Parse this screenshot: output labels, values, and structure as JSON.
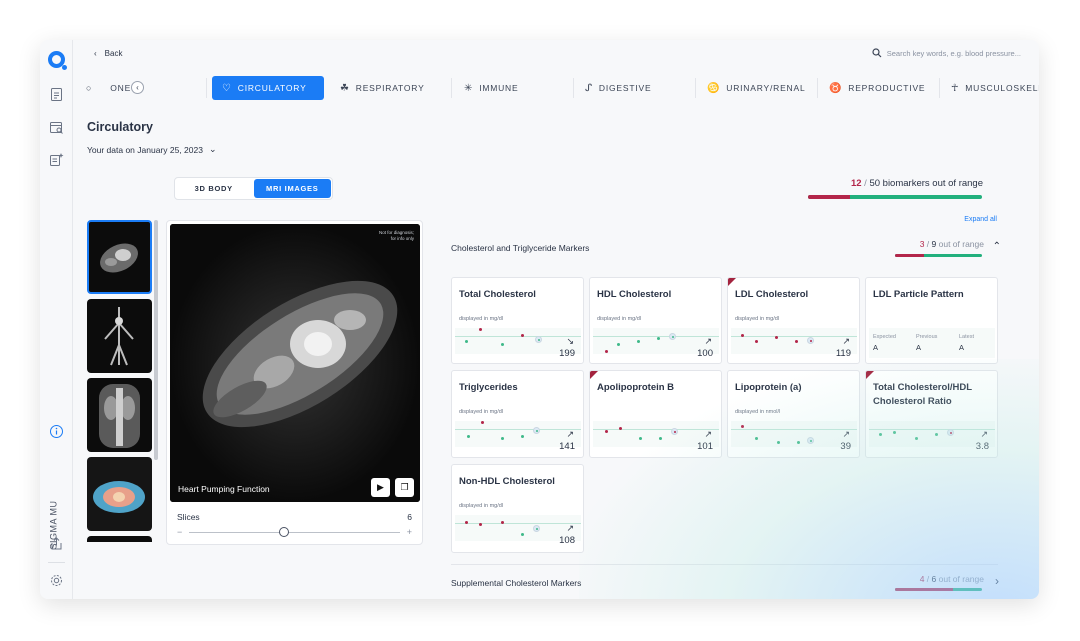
{
  "nav": {
    "back_label": "Back",
    "search_placeholder": "Search key words, e.g. blood pressure..."
  },
  "sidebar": {
    "vertical_label": "SIGMA MU"
  },
  "tabs": [
    {
      "label": "ONE",
      "icon": "bone-icon"
    },
    {
      "label": "CIRCULATORY",
      "icon": "heart-icon",
      "active": true
    },
    {
      "label": "RESPIRATORY",
      "icon": "lungs-icon"
    },
    {
      "label": "IMMUNE",
      "icon": "virus-icon"
    },
    {
      "label": "DIGESTIVE",
      "icon": "stomach-icon"
    },
    {
      "label": "URINARY/RENAL",
      "icon": "kidney-icon"
    },
    {
      "label": "REPRODUCTIVE",
      "icon": "uterus-icon"
    },
    {
      "label": "MUSCULOSKELETAL",
      "icon": "skeleton-icon"
    }
  ],
  "page": {
    "title": "Circulatory",
    "date_line": "Your data on January 25, 2023"
  },
  "view_toggle": {
    "options": [
      "3D BODY",
      "MRI IMAGES"
    ],
    "selected": "MRI IMAGES"
  },
  "viewer": {
    "note": "Not for diagnosis;\nfor info only",
    "caption": "Heart Pumping Function",
    "slices_label": "Slices",
    "slices_value": "6",
    "slider_minus": "−",
    "slider_plus": "+",
    "slider_level": 0.45
  },
  "summary": {
    "out_count": "12",
    "total": "50",
    "label": "biomarkers out of range",
    "fraction": 0.24
  },
  "expand_all": "Expand all",
  "sections": [
    {
      "title": "Cholesterol and Triglyceride Markers",
      "out": "3",
      "total": "9",
      "out_label": "out of range",
      "fraction": 0.33,
      "expanded": true,
      "cards": [
        {
          "title": "Total Cholesterol",
          "unit": "displayed in mg/dl",
          "value": "199",
          "trend": "↘",
          "flagged": false
        },
        {
          "title": "HDL Cholesterol",
          "unit": "displayed in mg/dl",
          "value": "100",
          "trend": "↗",
          "flagged": false
        },
        {
          "title": "LDL Cholesterol",
          "unit": "displayed in mg/dl",
          "value": "119",
          "trend": "↗",
          "flagged": true
        },
        {
          "title": "LDL Particle Pattern",
          "type": "pattern",
          "columns": [
            {
              "label": "Expected",
              "value": "A"
            },
            {
              "label": "Previous",
              "value": "A"
            },
            {
              "label": "Latest",
              "value": "A"
            }
          ]
        },
        {
          "title": "Triglycerides",
          "unit": "displayed in mg/dl",
          "value": "141",
          "trend": "↗",
          "flagged": false
        },
        {
          "title": "Apolipoprotein B",
          "unit": "",
          "value": "101",
          "trend": "↗",
          "flagged": true
        },
        {
          "title": "Lipoprotein (a)",
          "unit": "displayed in nmol/l",
          "value": "39",
          "trend": "↗",
          "flagged": false
        },
        {
          "title": "Total Cholesterol/HDL Cholesterol Ratio",
          "unit": "",
          "value": "3.8",
          "trend": "↗",
          "flagged": true
        },
        {
          "title": "Non-HDL Cholesterol",
          "unit": "displayed in mg/dl",
          "value": "108",
          "trend": "↗",
          "flagged": false
        }
      ]
    },
    {
      "title": "Supplemental Cholesterol Markers",
      "out": "4",
      "total": "6",
      "out_label": "out of range",
      "fraction": 0.67,
      "expanded": false
    }
  ],
  "colors": {
    "accent": "#1b7cf5",
    "out_of_range": "#b3264a",
    "in_range": "#22b07d"
  }
}
